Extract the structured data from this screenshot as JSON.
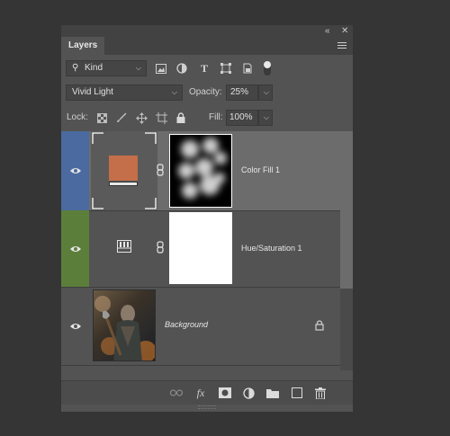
{
  "panel": {
    "tab_label": "Layers",
    "collapse_glyph": "«",
    "close_glyph": "✕"
  },
  "filter": {
    "kind_label": "Kind",
    "icons": [
      "pixel-filter-icon",
      "adjustment-filter-icon",
      "type-filter-icon",
      "shape-filter-icon",
      "smart-object-filter-icon",
      "filter-toggle-icon"
    ]
  },
  "blend": {
    "mode": "Vivid Light",
    "opacity_label": "Opacity:",
    "opacity_value": "25%"
  },
  "lock": {
    "label": "Lock:",
    "fill_label": "Fill:",
    "fill_value": "100%"
  },
  "layers": [
    {
      "name": "Color Fill 1",
      "tag_color": "#4a6aa0",
      "swatch_color": "#c46e4a",
      "selected": true
    },
    {
      "name": "Hue/Saturation 1",
      "tag_color": "#5b7f3a",
      "selected": false
    },
    {
      "name": "Background",
      "tag_color": null,
      "selected": false,
      "locked": true
    }
  ],
  "colors": {
    "panel_bg": "#535353",
    "selected_row": "#6c6c6c",
    "blue_tag": "#4a6aa0",
    "green_tag": "#5b7f3a"
  },
  "bottom_icons": [
    "link-layers-icon",
    "fx-icon",
    "add-mask-icon",
    "adjustment-layer-icon",
    "new-group-icon",
    "new-layer-icon",
    "delete-layer-icon"
  ],
  "fx_text": "fx"
}
